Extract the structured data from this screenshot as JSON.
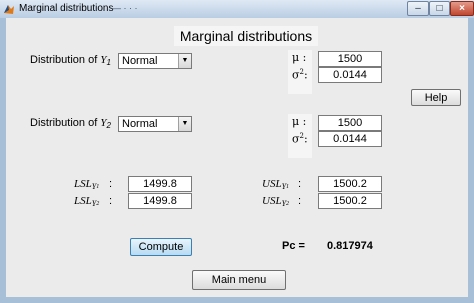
{
  "window": {
    "title": "Marginal distributions",
    "title_extra": "—  ·  ·  ·",
    "controls": {
      "minimize": "–",
      "maximize": "□",
      "close": "×"
    }
  },
  "panel": {
    "heading": "Marginal distributions"
  },
  "y1": {
    "label_prefix": "Distribution of ",
    "var": "Y",
    "sub": "1",
    "distribution": "Normal",
    "mu_label": "μ :",
    "sigma_label": "σ",
    "sigma_sup": "2",
    "sigma_colon": ":",
    "mu": "1500",
    "sigma2": "0.0144"
  },
  "y2": {
    "label_prefix": "Distribution of ",
    "var": "Y",
    "sub": "2",
    "distribution": "Normal",
    "mu_label": "μ :",
    "sigma_label": "σ",
    "sigma_sup": "2",
    "sigma_colon": ":",
    "mu": "1500",
    "sigma2": "0.0144"
  },
  "limits": {
    "lsl_text": "LSL",
    "usl_text": "USL",
    "var": "Y",
    "sub1": "1",
    "sub2": "2",
    "colon": ":",
    "lsl1": "1499.8",
    "lsl2": "1499.8",
    "usl1": "1500.2",
    "usl2": "1500.2"
  },
  "buttons": {
    "compute": "Compute",
    "help": "Help",
    "main_menu": "Main menu"
  },
  "result": {
    "label": "Pc =",
    "value": "0.817974"
  },
  "colors": {
    "title_icon": "#e07a18",
    "compute_accent": "#3c7fb1"
  },
  "icons": {
    "title_icon": "matlab-logo-icon",
    "select_arrow": "chevron-down-icon"
  }
}
